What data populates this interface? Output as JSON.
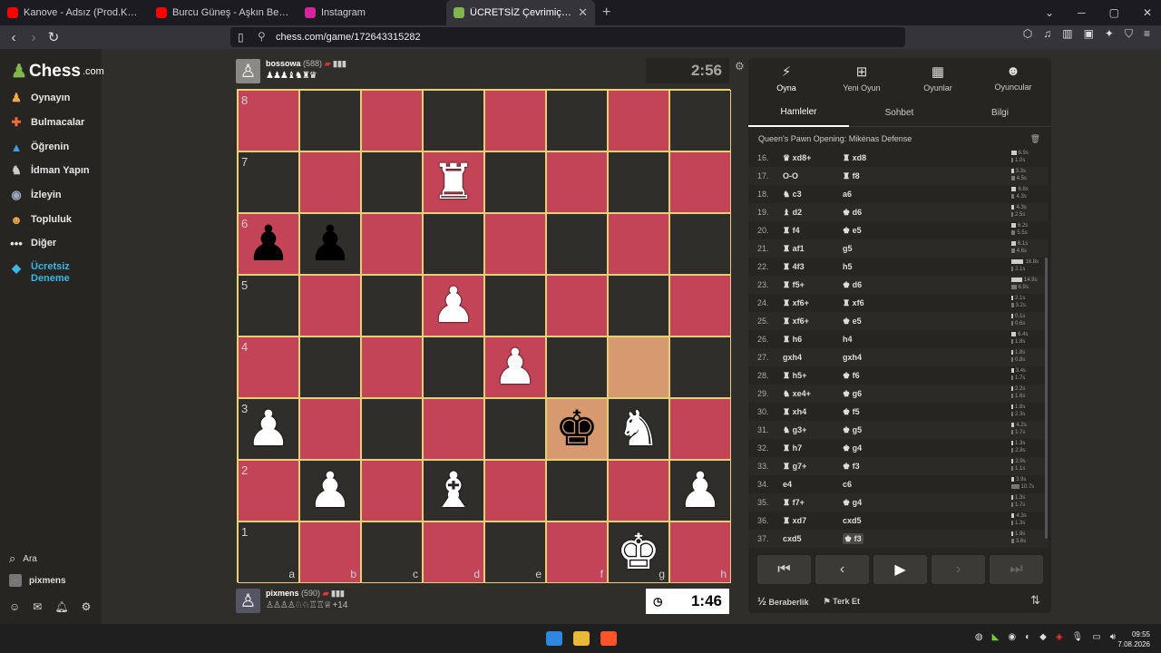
{
  "browser": {
    "tabs": [
      {
        "label": "Kanove - Adsız (Prod.Kanove) - YouTube",
        "icon": "youtube-icon",
        "color": "#ff0000"
      },
      {
        "label": "Burcu Güneş - Aşkın Beni Baştan",
        "icon": "youtube-icon",
        "color": "#ff0000"
      },
      {
        "label": "Instagram",
        "icon": "instagram-icon",
        "color": "#d6249f"
      },
      {
        "label": "ÜCRETSİZ Çevrimiçi Satranç Oyna",
        "icon": "chess-icon",
        "color": "#81b64c",
        "active": true
      }
    ],
    "new_tab": "+",
    "url": "chess.com/game/172643315282"
  },
  "sidebar": {
    "logo": "Chess",
    "logo_suffix": ".com",
    "items": [
      {
        "label": "Oynayın",
        "icon": "play-icon"
      },
      {
        "label": "Bulmacalar",
        "icon": "puzzle-icon"
      },
      {
        "label": "Öğrenin",
        "icon": "learn-icon"
      },
      {
        "label": "İdman Yapın",
        "icon": "train-icon"
      },
      {
        "label": "İzleyin",
        "icon": "watch-icon"
      },
      {
        "label": "Topluluk",
        "icon": "community-icon"
      },
      {
        "label": "Diğer",
        "icon": "more-icon"
      }
    ],
    "trial_line1": "Ücretsiz",
    "trial_line2": "Deneme",
    "search": "Ara",
    "user": "pixmens"
  },
  "top_player": {
    "name": "bossowa",
    "rating": "(588)",
    "captured": "♟♟♟♝♞♜♛",
    "clock": "2:56"
  },
  "bottom_player": {
    "name": "pixmens",
    "rating": "(590)",
    "captured": "♙♙♙♙♘♘♖♖♕",
    "advantage": "+14",
    "clock": "1:46"
  },
  "board": {
    "ranks": [
      "8",
      "7",
      "6",
      "5",
      "4",
      "3",
      "2",
      "1"
    ],
    "files": [
      "a",
      "b",
      "c",
      "d",
      "e",
      "f",
      "g",
      "h"
    ]
  },
  "panel": {
    "tabs": [
      {
        "label": "Oyna",
        "icon": "bolt-icon"
      },
      {
        "label": "Yeni Oyun",
        "icon": "plus-icon"
      },
      {
        "label": "Oyunlar",
        "icon": "board-icon"
      },
      {
        "label": "Oyuncular",
        "icon": "players-icon"
      }
    ],
    "subtabs": [
      "Hamleler",
      "Sohbet",
      "Bilgi"
    ],
    "opening": "Queen's Pawn Opening: Mikėnas Defense",
    "moves": [
      {
        "n": "16.",
        "w": "♛ xd8+",
        "b": "♜ xd8",
        "tw": "6.9s",
        "tb": "1.0s"
      },
      {
        "n": "17.",
        "w": "O-O",
        "b": "♜ f8",
        "tw": "3.3s",
        "tb": "4.5s"
      },
      {
        "n": "18.",
        "w": "♞ c3",
        "b": "a6",
        "tw": "6.8s",
        "tb": "4.3s"
      },
      {
        "n": "19.",
        "w": "♝ d2",
        "b": "♚ d6",
        "tw": "4.3s",
        "tb": "2.5s"
      },
      {
        "n": "20.",
        "w": "♜ f4",
        "b": "♚ e5",
        "tw": "6.2s",
        "tb": "5.5s"
      },
      {
        "n": "21.",
        "w": "♜ af1",
        "b": "g5",
        "tw": "6.1s",
        "tb": "4.6s"
      },
      {
        "n": "22.",
        "w": "♜ 4f3",
        "b": "h5",
        "tw": "16.8s",
        "tb": "2.1s"
      },
      {
        "n": "23.",
        "w": "♜ f5+",
        "b": "♚ d6",
        "tw": "14.9s",
        "tb": "6.9s"
      },
      {
        "n": "24.",
        "w": "♜ xf6+",
        "b": "♜ xf6",
        "tw": "2.1s",
        "tb": "3.2s"
      },
      {
        "n": "25.",
        "w": "♜ xf6+",
        "b": "♚ e5",
        "tw": "0.1s",
        "tb": "0.6s"
      },
      {
        "n": "26.",
        "w": "♜ h6",
        "b": "h4",
        "tw": "6.4s",
        "tb": "1.8s"
      },
      {
        "n": "27.",
        "w": "gxh4",
        "b": "gxh4",
        "tw": "1.8s",
        "tb": "0.8s"
      },
      {
        "n": "28.",
        "w": "♜ h5+",
        "b": "♚ f6",
        "tw": "3.4s",
        "tb": "1.7s"
      },
      {
        "n": "29.",
        "w": "♞ xe4+",
        "b": "♚ g6",
        "tw": "2.2s",
        "tb": "1.6s"
      },
      {
        "n": "30.",
        "w": "♜ xh4",
        "b": "♚ f5",
        "tw": "1.8s",
        "tb": "2.3s"
      },
      {
        "n": "31.",
        "w": "♞ g3+",
        "b": "♚ g5",
        "tw": "4.2s",
        "tb": "1.7s"
      },
      {
        "n": "32.",
        "w": "♜ h7",
        "b": "♚ g4",
        "tw": "1.3s",
        "tb": "2.8s"
      },
      {
        "n": "33.",
        "w": "♜ g7+",
        "b": "♚ f3",
        "tw": "2.9s",
        "tb": "1.1s"
      },
      {
        "n": "34.",
        "w": "e4",
        "b": "c6",
        "tw": "3.9s",
        "tb": "10.7s"
      },
      {
        "n": "35.",
        "w": "♜ f7+",
        "b": "♚ g4",
        "tw": "1.3s",
        "tb": "1.7s"
      },
      {
        "n": "36.",
        "w": "♜ xd7",
        "b": "cxd5",
        "tw": "4.3s",
        "tb": "1.3s"
      },
      {
        "n": "37.",
        "w": "cxd5",
        "b": "♚ f3",
        "tw": "1.9s",
        "tb": "3.6s",
        "current": true
      }
    ],
    "draw": "Beraberlik",
    "draw_prefix": "½",
    "resign": "Terk Et"
  },
  "taskbar": {
    "time": "09:55",
    "date": "7.08.2026"
  }
}
